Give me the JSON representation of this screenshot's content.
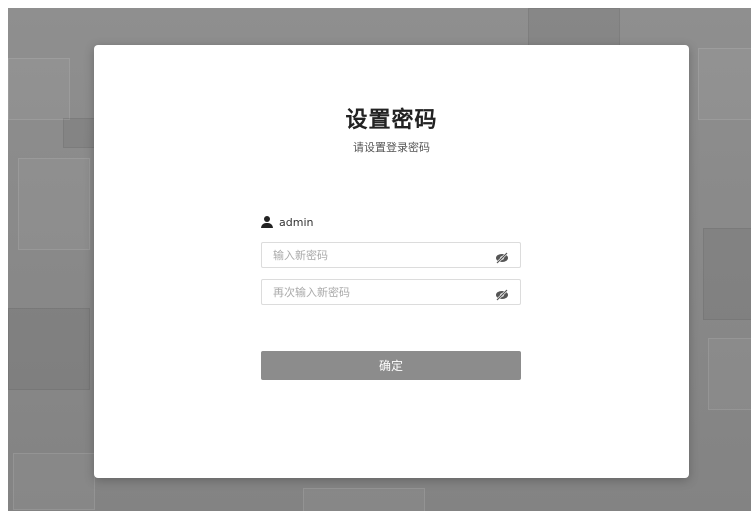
{
  "card": {
    "title": "设置密码",
    "subtitle": "请设置登录密码"
  },
  "user": {
    "icon": "user-icon",
    "name": "admin"
  },
  "form": {
    "new_password": {
      "placeholder": "输入新密码",
      "value": "",
      "toggle_icon": "eye-slash-icon"
    },
    "confirm_password": {
      "placeholder": "再次输入新密码",
      "value": "",
      "toggle_icon": "eye-slash-icon"
    },
    "submit_label": "确定"
  },
  "colors": {
    "background": "#8a8a8a",
    "card": "#ffffff",
    "button": "#8c8c8c",
    "input_border": "#dcdcdc"
  }
}
